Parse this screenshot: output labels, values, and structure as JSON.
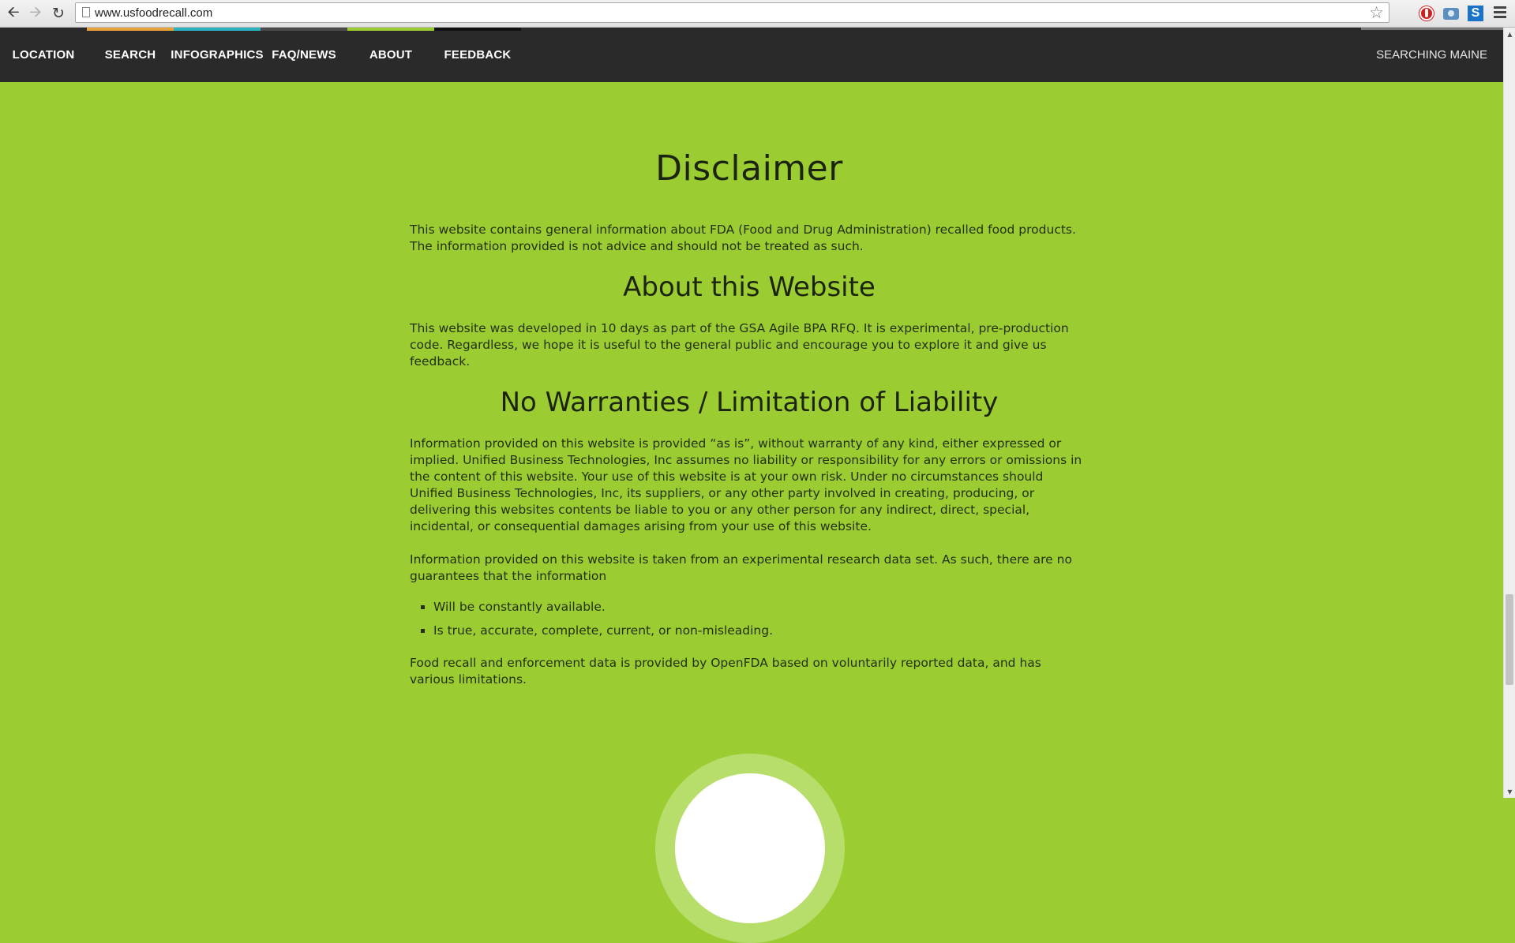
{
  "browser": {
    "url": "www.usfoodrecall.com",
    "icons": [
      "back-arrow-icon",
      "forward-arrow-icon",
      "reload-icon",
      "page-icon",
      "star-icon",
      "stop-extension-icon",
      "camera-extension-icon",
      "s-extension-icon",
      "menu-icon"
    ]
  },
  "nav": {
    "items": [
      {
        "label": "LOCATION",
        "accent": ""
      },
      {
        "label": "SEARCH",
        "accent": "#e8a23a"
      },
      {
        "label": "INFOGRAPHICS",
        "accent": "#2bb3c0"
      },
      {
        "label": "FAQ/NEWS",
        "accent": "#4a4a4a"
      },
      {
        "label": "ABOUT",
        "accent": "#9bcd32"
      },
      {
        "label": "FEEDBACK",
        "accent": "#111111"
      }
    ],
    "status": "SEARCHING MAINE"
  },
  "content": {
    "disclaimer_title": "Disclaimer",
    "disclaimer_text": "This website contains general information about FDA (Food and Drug Administration) recalled food products. The information provided is not advice and should not be treated as such.",
    "about_title": "About this Website",
    "about_text": "This website was developed in 10 days as part of the GSA Agile BPA RFQ. It is experimental, pre-production code. Regardless, we hope it is useful to the general public and encourage you to explore it and give us feedback.",
    "warranty_title": "No Warranties / Limitation of Liability",
    "warranty_text_1": "Information provided on this website is provided “as is”, without warranty of any kind, either expressed or implied. Unified Business Technologies, Inc assumes no liability or responsibility for any errors or omissions in the content of this website. Your use of this website is at your own risk. Under no circumstances should Unified Business Technologies, Inc, its suppliers, or any other party involved in creating, producing, or delivering this websites contents be liable to you or any other person for any indirect, direct, special, incidental, or consequential damages arising from your use of this website.",
    "warranty_text_2": "Information provided on this website is taken from an experimental research data set. As such, there are no guarantees that the information",
    "bullets": [
      "Will be constantly available.",
      "Is true, accurate, complete, current, or non-misleading."
    ],
    "openfda_text": "Food recall and enforcement data is provided by OpenFDA based on voluntarily reported data, and has various limitations."
  },
  "colors": {
    "page_background": "#9bcd32",
    "nav_background": "#2a2a2a"
  }
}
